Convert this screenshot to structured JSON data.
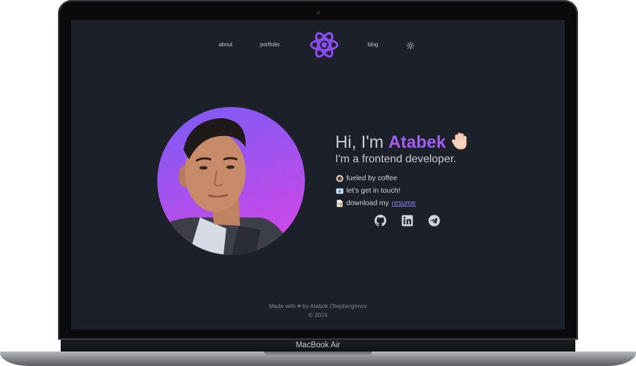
{
  "device": {
    "model": "MacBook Air"
  },
  "nav": {
    "links": [
      {
        "label": "about"
      },
      {
        "label": "portfolio"
      },
      {
        "label": "blog"
      }
    ],
    "logo_icon": "atom-icon",
    "theme_toggle_icon": "sun-icon"
  },
  "hero": {
    "greeting_prefix": "Hi, I'm",
    "name": "Atabek",
    "wave_icon": "waving-hand-icon",
    "subtitle": "I'm a frontend developer.",
    "lines": [
      {
        "icon": "coffee-icon",
        "text": "fueled by coffee"
      },
      {
        "icon": "envelope-icon",
        "text": "let's get in touch!"
      },
      {
        "icon": "document-icon",
        "text": "download my",
        "link": "resume"
      }
    ],
    "socials": [
      {
        "icon": "github-icon"
      },
      {
        "icon": "linkedin-icon"
      },
      {
        "icon": "telegram-icon"
      }
    ]
  },
  "footer": {
    "made_with": "Made with ♥ by Atabek Otepbergenov",
    "copyright": "© 2024"
  },
  "colors": {
    "page_bg": "#1c2028",
    "accent": "#a35ef2",
    "link": "#8b85f5",
    "avatar_gradient_start": "#7c5cf4",
    "avatar_gradient_end": "#d944e6"
  }
}
